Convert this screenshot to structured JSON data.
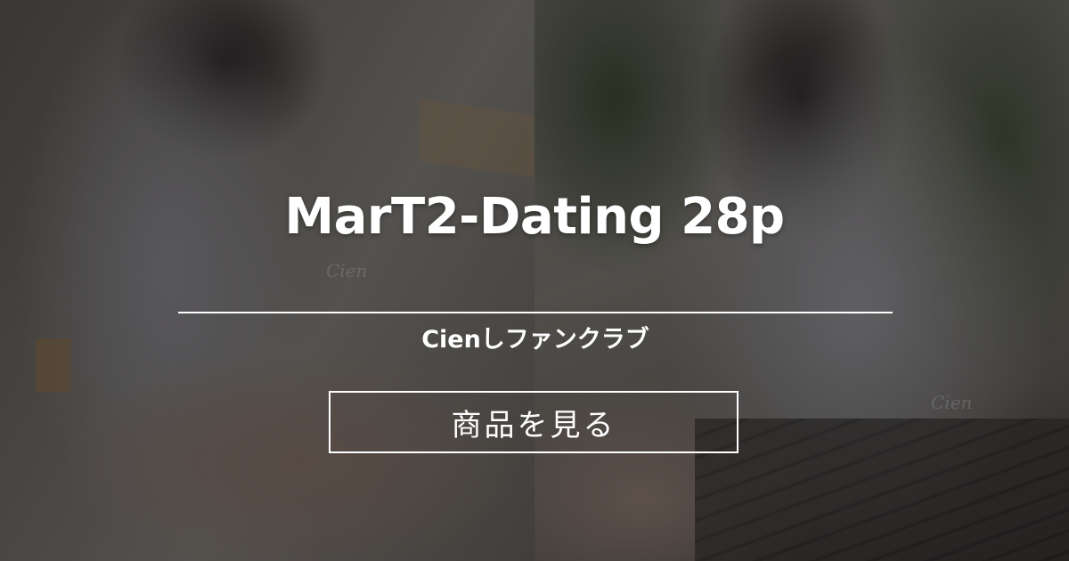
{
  "card": {
    "title": "MarT2-Dating 28p",
    "subtitle": "Cienしファンクラブ",
    "button_label": "商品を見る",
    "watermark": "Cien"
  },
  "images": {
    "left_photo": "photo-left",
    "right_photo": "photo-right"
  },
  "colors": {
    "text": "#ffffff",
    "overlay": "rgba(0,0,0,0.48)",
    "button_border": "#ffffff"
  }
}
